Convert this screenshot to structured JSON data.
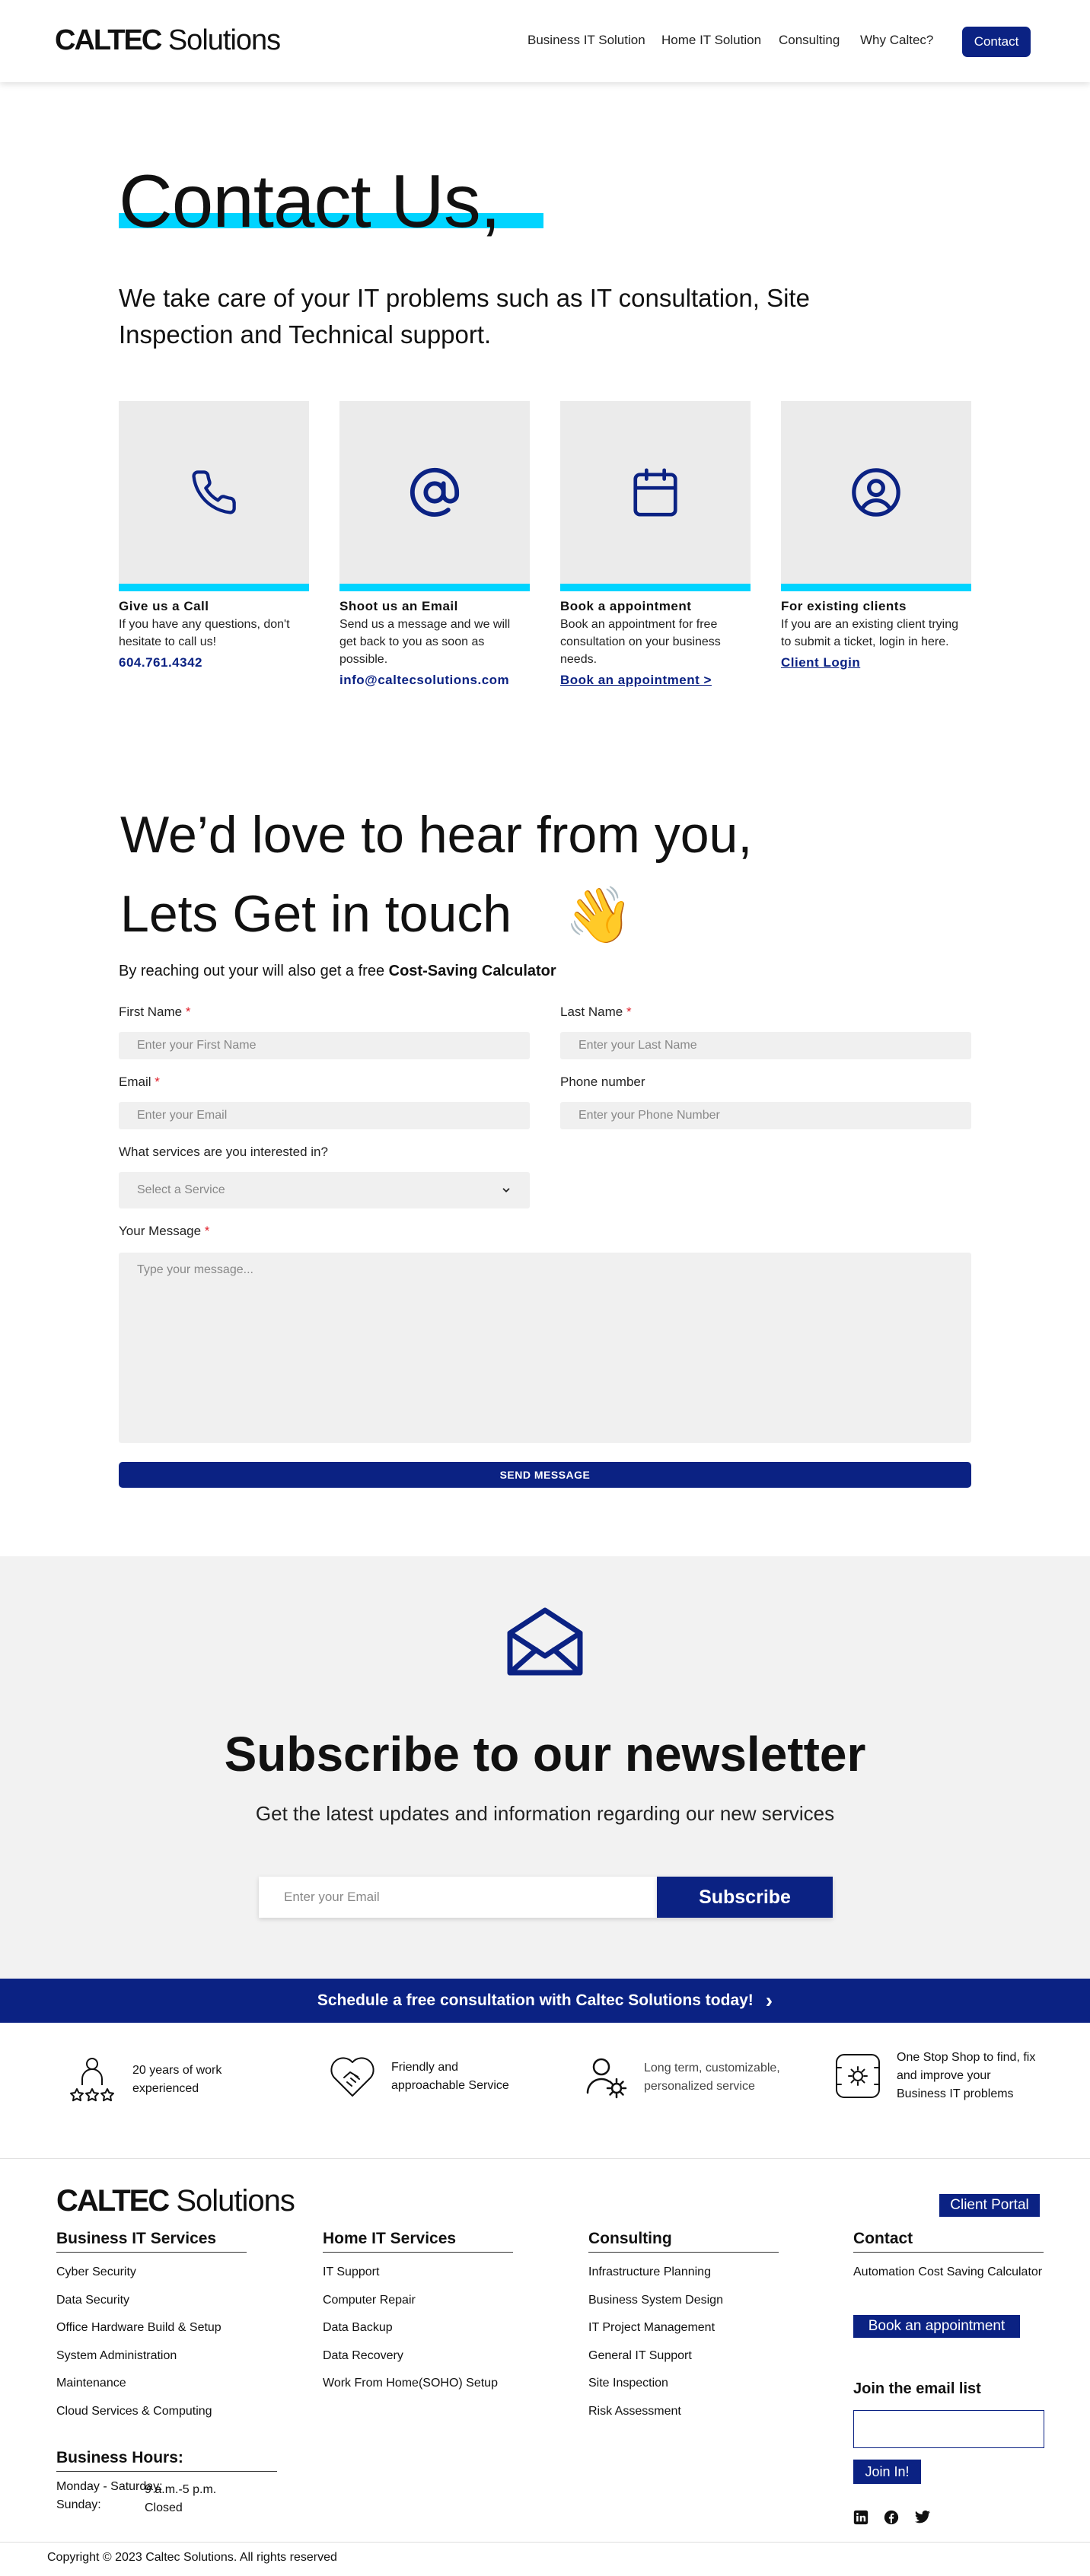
{
  "header": {
    "logo_bold": "CALTEC",
    "logo_rest": " Solutions",
    "nav": [
      "Business IT Solution",
      "Home IT Solution",
      "Consulting",
      "Why Caltec?"
    ],
    "contact_label": "Contact"
  },
  "hero": {
    "title": "Contact Us,",
    "subtitle": "We take care of your IT problems such as IT consultation, Site Inspection and Technical support."
  },
  "cards": [
    {
      "icon": "phone-icon",
      "title": "Give us a Call",
      "text": "If you have any questions, don't hesitate to call us!",
      "link": "604.761.4342"
    },
    {
      "icon": "at-sign-icon",
      "title": "Shoot us an Email",
      "text": "Send us a message and we will get back to you as soon as possible.",
      "link": "info@caltecsolutions.com"
    },
    {
      "icon": "calendar-icon",
      "title": "Book a appointment",
      "text": "Book an appointment for free consultation on your business needs.",
      "link": "Book an appointment >"
    },
    {
      "icon": "user-circle-icon",
      "title": "For existing clients",
      "text": "If you are an existing client trying to submit a ticket, login in here.",
      "link": "Client Login"
    }
  ],
  "form": {
    "heading1": "We’d love to hear from you,",
    "heading2": "Lets Get in touch",
    "lead_text": "By reaching out your will also get a free ",
    "lead_bold": "Cost-Saving Calculator",
    "required_mark": "*",
    "first_name_label": "First Name",
    "first_name_placeholder": "Enter your First Name",
    "last_name_label": "Last Name",
    "last_name_placeholder": "Enter your Last Name",
    "email_label": "Email",
    "email_placeholder": "Enter your Email",
    "phone_label": "Phone number",
    "phone_placeholder": "Enter your Phone Number",
    "service_label": "What services are you interested in?",
    "service_selected": "Select a Service",
    "message_label": "Your Message",
    "message_placeholder": "Type your message...",
    "send_label": "SEND MESSAGE"
  },
  "newsletter": {
    "title": "Subscribe to our newsletter",
    "subtitle": "Get the latest updates and information regarding our new services",
    "email_placeholder": "Enter your Email",
    "button": "Subscribe"
  },
  "banner": {
    "text": "Schedule a free consultation with Caltec Solutions today!",
    "arrow": "›"
  },
  "features": [
    {
      "icon": "award-person-icon",
      "line1": "20 years of work",
      "line2": "experienced"
    },
    {
      "icon": "handshake-heart-icon",
      "line1": "Friendly and",
      "line2": "approachable Service"
    },
    {
      "icon": "user-gear-icon",
      "line1": "Long term, customizable,",
      "line2": "personalized service"
    },
    {
      "icon": "settings-screen-icon",
      "line1": "One Stop Shop to find, fix",
      "line2": "and improve your",
      "line3": "Business IT problems"
    }
  ],
  "footer": {
    "logo_bold": "CALTEC",
    "logo_rest": " Solutions",
    "client_portal": "Client Portal",
    "business": {
      "title": "Business IT Services",
      "items": [
        "Cyber Security",
        "Data Security",
        "Office Hardware Build & Setup",
        "System Administration",
        "Maintenance",
        "Cloud Services & Computing"
      ]
    },
    "home": {
      "title": "Home IT Services",
      "items": [
        "IT Support",
        "Computer Repair",
        "Data Backup",
        "Data Recovery",
        "Work From Home(SOHO) Setup"
      ]
    },
    "consulting": {
      "title": "Consulting",
      "items": [
        "Infrastructure Planning",
        "Business System Design",
        "IT Project Management",
        "General IT Support",
        "Site Inspection",
        "Risk Assessment"
      ]
    },
    "contact": {
      "title": "Contact",
      "items": [
        "Automation Cost Saving Calculator"
      ]
    },
    "book_button": "Book an appointment",
    "join_title": "Join the email list",
    "join_button": "Join In!",
    "hours_title": "Business Hours:",
    "hours_days1": "Monday - Saturday:",
    "hours_days2": "Sunday:",
    "hours_time1": "9 a.m.-5 p.m.",
    "hours_time2": "Closed",
    "copyright": "Copyright © 2023 Caltec Solutions. All rights reserved"
  },
  "colors": {
    "navy": "#0b2283",
    "cyan": "#00d4ff",
    "grey_panel": "#ebebeb"
  }
}
